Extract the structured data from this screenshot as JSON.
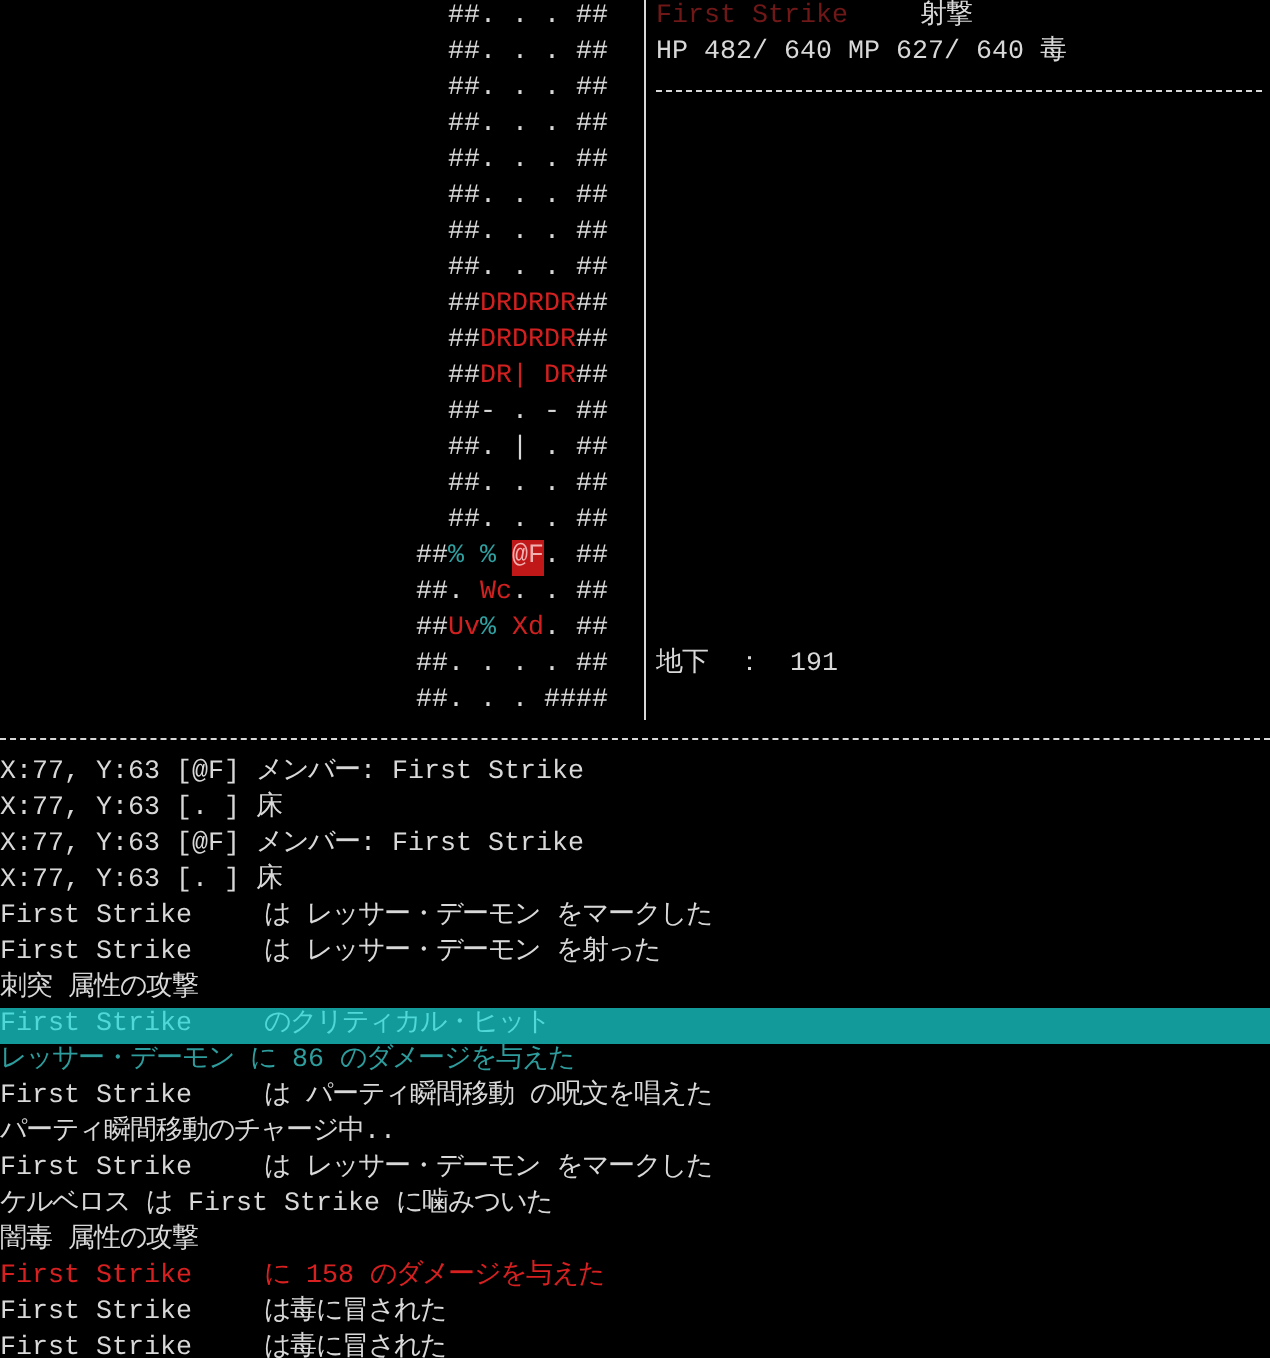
{
  "map": {
    "lines": [
      {
        "spans": [
          {
            "text": "##. . . ##",
            "color": "#d8d8d8"
          }
        ]
      },
      {
        "spans": [
          {
            "text": "##. . . ##",
            "color": "#d8d8d8"
          }
        ]
      },
      {
        "spans": [
          {
            "text": "##. . . ##",
            "color": "#d8d8d8"
          }
        ]
      },
      {
        "spans": [
          {
            "text": "##. . . ##",
            "color": "#d8d8d8"
          }
        ]
      },
      {
        "spans": [
          {
            "text": "##. . . ##",
            "color": "#d8d8d8"
          }
        ]
      },
      {
        "spans": [
          {
            "text": "##. . . ##",
            "color": "#d8d8d8"
          }
        ]
      },
      {
        "spans": [
          {
            "text": "##. . . ##",
            "color": "#d8d8d8"
          }
        ]
      },
      {
        "spans": [
          {
            "text": "##. . . ##",
            "color": "#d8d8d8"
          }
        ]
      },
      {
        "spans": [
          {
            "text": "##",
            "color": "#d8d8d8"
          },
          {
            "text": "DRDRDR",
            "color": "#d02020"
          },
          {
            "text": "##",
            "color": "#d8d8d8"
          }
        ]
      },
      {
        "spans": [
          {
            "text": "##",
            "color": "#d8d8d8"
          },
          {
            "text": "DRDRDR",
            "color": "#d02020"
          },
          {
            "text": "##",
            "color": "#d8d8d8"
          }
        ]
      },
      {
        "spans": [
          {
            "text": "##",
            "color": "#d8d8d8"
          },
          {
            "text": "DR| DR",
            "color": "#d02020"
          },
          {
            "text": "##",
            "color": "#d8d8d8"
          }
        ]
      },
      {
        "spans": [
          {
            "text": "##- . - ##",
            "color": "#d8d8d8"
          }
        ]
      },
      {
        "spans": [
          {
            "text": "##. | . ##",
            "color": "#d8d8d8"
          }
        ]
      },
      {
        "spans": [
          {
            "text": "##. . . ##",
            "color": "#d8d8d8"
          }
        ]
      },
      {
        "spans": [
          {
            "text": "##. . . ##",
            "color": "#d8d8d8"
          }
        ]
      },
      {
        "spans": [
          {
            "text": "##",
            "color": "#d8d8d8"
          },
          {
            "text": "% % ",
            "color": "#30a0a0"
          },
          {
            "text": "@F",
            "color": "#c01818",
            "kind": "cursor"
          },
          {
            "text": ". ##",
            "color": "#d8d8d8"
          }
        ]
      },
      {
        "spans": [
          {
            "text": "##. ",
            "color": "#d8d8d8"
          },
          {
            "text": "Wc",
            "color": "#d02020"
          },
          {
            "text": ". . ##",
            "color": "#d8d8d8"
          }
        ]
      },
      {
        "spans": [
          {
            "text": "##",
            "color": "#d8d8d8"
          },
          {
            "text": "Uv",
            "color": "#d02020"
          },
          {
            "text": "% ",
            "color": "#30a0a0"
          },
          {
            "text": "Xd",
            "color": "#d02020"
          },
          {
            "text": ". ##",
            "color": "#d8d8d8"
          }
        ]
      },
      {
        "spans": [
          {
            "text": "##. . . . ##",
            "color": "#d8d8d8"
          }
        ]
      },
      {
        "spans": [
          {
            "text": "##. . . ####",
            "color": "#d8d8d8"
          }
        ]
      }
    ]
  },
  "party_panel": {
    "member_name": "First Strike",
    "action": "射撃",
    "stats": "HP 482/ 640 MP 627/ 640 毒",
    "floor_label": "地下",
    "floor_sep": "：",
    "floor_value": "191"
  },
  "log": [
    {
      "kind": "normal",
      "parts": [
        "X:77, Y:63 [@F] メンバー: First Strike"
      ]
    },
    {
      "kind": "normal",
      "parts": [
        "X:77, Y:63 [. ] 床"
      ]
    },
    {
      "kind": "normal",
      "parts": [
        "X:77, Y:63 [@F] メンバー: First Strike"
      ]
    },
    {
      "kind": "normal",
      "parts": [
        "X:77, Y:63 [. ] 床"
      ]
    },
    {
      "kind": "normal",
      "name": "First Strike",
      "parts": [
        "は レッサー・デーモン をマークした"
      ]
    },
    {
      "kind": "normal",
      "name": "First Strike",
      "parts": [
        "は レッサー・デーモン を射った"
      ]
    },
    {
      "kind": "normal",
      "parts": [
        "刺突 属性の攻撃"
      ]
    },
    {
      "kind": "highlight",
      "name": "First Strike",
      "parts": [
        "のクリティカル・ヒット"
      ]
    },
    {
      "kind": "muted",
      "parts": [
        "レッサー・デーモン に 86 のダメージを与えた"
      ]
    },
    {
      "kind": "normal",
      "name": "First Strike",
      "parts": [
        "は パーティ瞬間移動 の呪文を唱えた"
      ]
    },
    {
      "kind": "normal",
      "parts": [
        "パーティ瞬間移動のチャージ中.."
      ]
    },
    {
      "kind": "normal",
      "name": "First Strike",
      "parts": [
        "は レッサー・デーモン をマークした"
      ]
    },
    {
      "kind": "normal",
      "prefix": "ケルベロス は",
      "name": "First Strike",
      "parts": [
        "に噛みついた"
      ]
    },
    {
      "kind": "normal",
      "parts": [
        "闇毒 属性の攻撃"
      ]
    },
    {
      "kind": "alert",
      "name": "First Strike",
      "parts": [
        "に 158 のダメージを与えた"
      ]
    },
    {
      "kind": "normal",
      "name": "First Strike",
      "parts": [
        "は毒に冒された"
      ]
    },
    {
      "kind": "normal",
      "name": "First Strike",
      "parts": [
        "は毒に冒された"
      ]
    }
  ]
}
